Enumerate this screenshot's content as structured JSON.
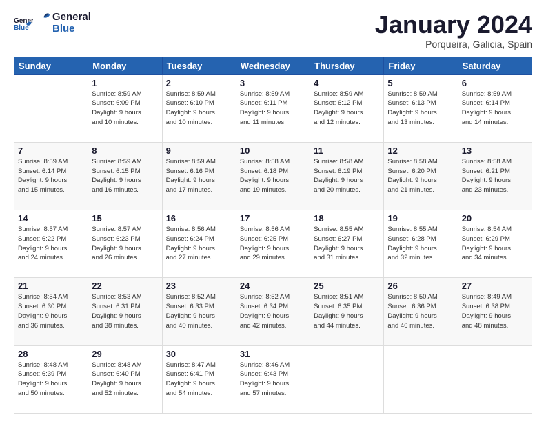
{
  "logo": {
    "text_general": "General",
    "text_blue": "Blue"
  },
  "header": {
    "month_title": "January 2024",
    "location": "Porqueira, Galicia, Spain"
  },
  "days_of_week": [
    "Sunday",
    "Monday",
    "Tuesday",
    "Wednesday",
    "Thursday",
    "Friday",
    "Saturday"
  ],
  "weeks": [
    [
      {
        "day": "",
        "info": ""
      },
      {
        "day": "1",
        "info": "Sunrise: 8:59 AM\nSunset: 6:09 PM\nDaylight: 9 hours\nand 10 minutes."
      },
      {
        "day": "2",
        "info": "Sunrise: 8:59 AM\nSunset: 6:10 PM\nDaylight: 9 hours\nand 10 minutes."
      },
      {
        "day": "3",
        "info": "Sunrise: 8:59 AM\nSunset: 6:11 PM\nDaylight: 9 hours\nand 11 minutes."
      },
      {
        "day": "4",
        "info": "Sunrise: 8:59 AM\nSunset: 6:12 PM\nDaylight: 9 hours\nand 12 minutes."
      },
      {
        "day": "5",
        "info": "Sunrise: 8:59 AM\nSunset: 6:13 PM\nDaylight: 9 hours\nand 13 minutes."
      },
      {
        "day": "6",
        "info": "Sunrise: 8:59 AM\nSunset: 6:14 PM\nDaylight: 9 hours\nand 14 minutes."
      }
    ],
    [
      {
        "day": "7",
        "info": "Sunrise: 8:59 AM\nSunset: 6:14 PM\nDaylight: 9 hours\nand 15 minutes."
      },
      {
        "day": "8",
        "info": "Sunrise: 8:59 AM\nSunset: 6:15 PM\nDaylight: 9 hours\nand 16 minutes."
      },
      {
        "day": "9",
        "info": "Sunrise: 8:59 AM\nSunset: 6:16 PM\nDaylight: 9 hours\nand 17 minutes."
      },
      {
        "day": "10",
        "info": "Sunrise: 8:58 AM\nSunset: 6:18 PM\nDaylight: 9 hours\nand 19 minutes."
      },
      {
        "day": "11",
        "info": "Sunrise: 8:58 AM\nSunset: 6:19 PM\nDaylight: 9 hours\nand 20 minutes."
      },
      {
        "day": "12",
        "info": "Sunrise: 8:58 AM\nSunset: 6:20 PM\nDaylight: 9 hours\nand 21 minutes."
      },
      {
        "day": "13",
        "info": "Sunrise: 8:58 AM\nSunset: 6:21 PM\nDaylight: 9 hours\nand 23 minutes."
      }
    ],
    [
      {
        "day": "14",
        "info": "Sunrise: 8:57 AM\nSunset: 6:22 PM\nDaylight: 9 hours\nand 24 minutes."
      },
      {
        "day": "15",
        "info": "Sunrise: 8:57 AM\nSunset: 6:23 PM\nDaylight: 9 hours\nand 26 minutes."
      },
      {
        "day": "16",
        "info": "Sunrise: 8:56 AM\nSunset: 6:24 PM\nDaylight: 9 hours\nand 27 minutes."
      },
      {
        "day": "17",
        "info": "Sunrise: 8:56 AM\nSunset: 6:25 PM\nDaylight: 9 hours\nand 29 minutes."
      },
      {
        "day": "18",
        "info": "Sunrise: 8:55 AM\nSunset: 6:27 PM\nDaylight: 9 hours\nand 31 minutes."
      },
      {
        "day": "19",
        "info": "Sunrise: 8:55 AM\nSunset: 6:28 PM\nDaylight: 9 hours\nand 32 minutes."
      },
      {
        "day": "20",
        "info": "Sunrise: 8:54 AM\nSunset: 6:29 PM\nDaylight: 9 hours\nand 34 minutes."
      }
    ],
    [
      {
        "day": "21",
        "info": "Sunrise: 8:54 AM\nSunset: 6:30 PM\nDaylight: 9 hours\nand 36 minutes."
      },
      {
        "day": "22",
        "info": "Sunrise: 8:53 AM\nSunset: 6:31 PM\nDaylight: 9 hours\nand 38 minutes."
      },
      {
        "day": "23",
        "info": "Sunrise: 8:52 AM\nSunset: 6:33 PM\nDaylight: 9 hours\nand 40 minutes."
      },
      {
        "day": "24",
        "info": "Sunrise: 8:52 AM\nSunset: 6:34 PM\nDaylight: 9 hours\nand 42 minutes."
      },
      {
        "day": "25",
        "info": "Sunrise: 8:51 AM\nSunset: 6:35 PM\nDaylight: 9 hours\nand 44 minutes."
      },
      {
        "day": "26",
        "info": "Sunrise: 8:50 AM\nSunset: 6:36 PM\nDaylight: 9 hours\nand 46 minutes."
      },
      {
        "day": "27",
        "info": "Sunrise: 8:49 AM\nSunset: 6:38 PM\nDaylight: 9 hours\nand 48 minutes."
      }
    ],
    [
      {
        "day": "28",
        "info": "Sunrise: 8:48 AM\nSunset: 6:39 PM\nDaylight: 9 hours\nand 50 minutes."
      },
      {
        "day": "29",
        "info": "Sunrise: 8:48 AM\nSunset: 6:40 PM\nDaylight: 9 hours\nand 52 minutes."
      },
      {
        "day": "30",
        "info": "Sunrise: 8:47 AM\nSunset: 6:41 PM\nDaylight: 9 hours\nand 54 minutes."
      },
      {
        "day": "31",
        "info": "Sunrise: 8:46 AM\nSunset: 6:43 PM\nDaylight: 9 hours\nand 57 minutes."
      },
      {
        "day": "",
        "info": ""
      },
      {
        "day": "",
        "info": ""
      },
      {
        "day": "",
        "info": ""
      }
    ]
  ]
}
